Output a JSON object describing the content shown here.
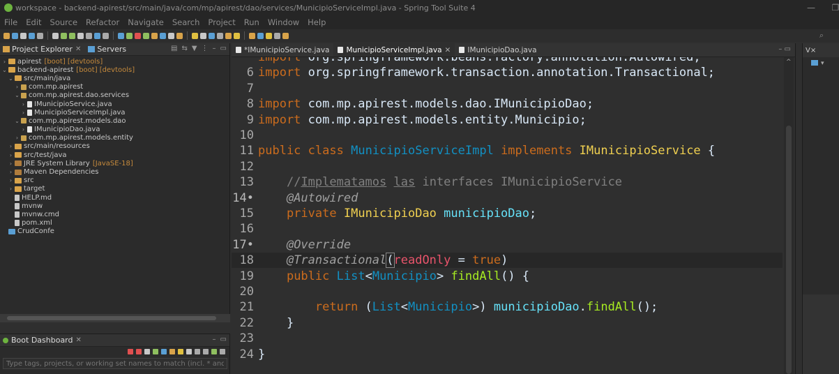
{
  "window": {
    "title": "workspace - backend-apirest/src/main/java/com/mp/apirest/dao/services/MunicipioServiceImpl.java - Spring Tool Suite 4",
    "minimize": "—",
    "restore": "❐"
  },
  "menubar": [
    "File",
    "Edit",
    "Source",
    "Refactor",
    "Navigate",
    "Search",
    "Project",
    "Run",
    "Window",
    "Help"
  ],
  "explorer": {
    "tab_project": "Project Explorer",
    "tab_servers": "Servers",
    "tree": [
      {
        "label": "apirest",
        "deco": "[boot] [devtools]",
        "depth": 0,
        "arrow": "›",
        "icon": "project"
      },
      {
        "label": "backend-apirest",
        "deco": "[boot] [devtools]",
        "depth": 0,
        "arrow": "⌄",
        "icon": "project"
      },
      {
        "label": "src/main/java",
        "deco": "",
        "depth": 1,
        "arrow": "⌄",
        "icon": "folder"
      },
      {
        "label": "com.mp.apirest",
        "deco": "",
        "depth": 2,
        "arrow": "›",
        "icon": "pkg"
      },
      {
        "label": "com.mp.apirest.dao.services",
        "deco": "",
        "depth": 2,
        "arrow": "⌄",
        "icon": "pkg"
      },
      {
        "label": "IMunicipioService.java",
        "deco": "",
        "depth": 3,
        "arrow": "›",
        "icon": "java"
      },
      {
        "label": "MunicipioServiceImpl.java",
        "deco": "",
        "depth": 3,
        "arrow": "›",
        "icon": "java"
      },
      {
        "label": "com.mp.apirest.models.dao",
        "deco": "",
        "depth": 2,
        "arrow": "⌄",
        "icon": "pkg"
      },
      {
        "label": "IMunicipioDao.java",
        "deco": "",
        "depth": 3,
        "arrow": "›",
        "icon": "java"
      },
      {
        "label": "com.mp.apirest.models.entity",
        "deco": "",
        "depth": 2,
        "arrow": "›",
        "icon": "pkg"
      },
      {
        "label": "src/main/resources",
        "deco": "",
        "depth": 1,
        "arrow": "›",
        "icon": "folder"
      },
      {
        "label": "src/test/java",
        "deco": "",
        "depth": 1,
        "arrow": "›",
        "icon": "folder"
      },
      {
        "label": "JRE System Library",
        "deco": "[JavaSE-18]",
        "depth": 1,
        "arrow": "›",
        "icon": "lib"
      },
      {
        "label": "Maven Dependencies",
        "deco": "",
        "depth": 1,
        "arrow": "›",
        "icon": "lib"
      },
      {
        "label": "src",
        "deco": "",
        "depth": 1,
        "arrow": "›",
        "icon": "folder"
      },
      {
        "label": "target",
        "deco": "",
        "depth": 1,
        "arrow": "›",
        "icon": "folder"
      },
      {
        "label": "HELP.md",
        "deco": "",
        "depth": 1,
        "arrow": "",
        "icon": "file"
      },
      {
        "label": "mvnw",
        "deco": "",
        "depth": 1,
        "arrow": "",
        "icon": "file"
      },
      {
        "label": "mvnw.cmd",
        "deco": "",
        "depth": 1,
        "arrow": "",
        "icon": "file"
      },
      {
        "label": "pom.xml",
        "deco": "",
        "depth": 1,
        "arrow": "",
        "icon": "file"
      },
      {
        "label": "CrudConfe",
        "deco": "",
        "depth": 0,
        "arrow": "",
        "icon": "server"
      }
    ]
  },
  "boot_dashboard": {
    "tab": "Boot Dashboard",
    "filter_placeholder": "Type tags, projects, or working set names to match (incl. * and ? wildcard"
  },
  "editor": {
    "tabs": [
      {
        "label": "*IMunicipioService.java",
        "active": false,
        "closable": false
      },
      {
        "label": "MunicipioServiceImpl.java",
        "active": true,
        "closable": true
      },
      {
        "label": "IMunicipioDao.java",
        "active": false,
        "closable": false
      }
    ],
    "current_line": 18,
    "lines": [
      {
        "n": "",
        "mark": false,
        "html": "<span class=\"kw\">import</span> org.springframework.beans.factory.annotation.Autowired;"
      },
      {
        "n": "6",
        "mark": false,
        "html": "<span class=\"kw\">import</span> org.springframework.transaction.annotation.Transactional;"
      },
      {
        "n": "7",
        "mark": false,
        "html": ""
      },
      {
        "n": "8",
        "mark": false,
        "html": "<span class=\"kw\">import</span> com.mp.apirest.models.dao.IMunicipioDao;"
      },
      {
        "n": "9",
        "mark": false,
        "html": "<span class=\"kw\">import</span> com.mp.apirest.models.entity.Municipio;"
      },
      {
        "n": "10",
        "mark": false,
        "html": ""
      },
      {
        "n": "11",
        "mark": false,
        "html": "<span class=\"kw\">public</span> <span class=\"kw\">class</span> <span class=\"ty\">MunicipioServiceImpl</span> <span class=\"kw\">implements</span> <span class=\"ty\" style=\"color:#f0d050\">IMunicipioService</span> {"
      },
      {
        "n": "12",
        "mark": false,
        "html": ""
      },
      {
        "n": "13",
        "mark": false,
        "html": "    <span class=\"cm\">//<u>Implematamos</u> <u>las</u> interfaces IMunicipioService</span>"
      },
      {
        "n": "14•",
        "mark": true,
        "html": "    <span class=\"an\">@Autowired</span>"
      },
      {
        "n": "15",
        "mark": false,
        "html": "    <span class=\"kw\">private</span> <span class=\"ty\" style=\"color:#f0d050\">IMunicipioDao</span> <span class=\"fld\">municipioDao</span>;"
      },
      {
        "n": "16",
        "mark": false,
        "html": ""
      },
      {
        "n": "17•",
        "mark": true,
        "html": "    <span class=\"an\">@Override</span>"
      },
      {
        "n": "18",
        "mark": false,
        "html": "    <span class=\"an\">@Transactional</span><span class=\"paren-box\">(</span><span class=\"attr\">readOnly</span> = <span class=\"kw\">true</span>)"
      },
      {
        "n": "19",
        "mark": false,
        "html": "    <span class=\"kw\">public</span> <span class=\"ty\">List</span>&lt;<span class=\"ty\">Municipio</span>&gt; <span class=\"fn\">findAll</span>() {"
      },
      {
        "n": "20",
        "mark": false,
        "html": ""
      },
      {
        "n": "21",
        "mark": false,
        "html": "        <span class=\"kw\">return</span> (<span class=\"ty\">List</span>&lt;<span class=\"ty\">Municipio</span>&gt;) <span class=\"fld\">municipioDao</span>.<span class=\"fn\">findAll</span>();"
      },
      {
        "n": "22",
        "mark": false,
        "html": "    }"
      },
      {
        "n": "23",
        "mark": false,
        "html": ""
      },
      {
        "n": "24",
        "mark": false,
        "html": "}"
      }
    ]
  },
  "right_panel": {
    "tab": "V×"
  },
  "colors": {
    "accent_spring": "#6db33f",
    "keyword": "#cc6c1d",
    "type": "#1290c3",
    "method": "#a7ec21",
    "field": "#66e1f8"
  }
}
